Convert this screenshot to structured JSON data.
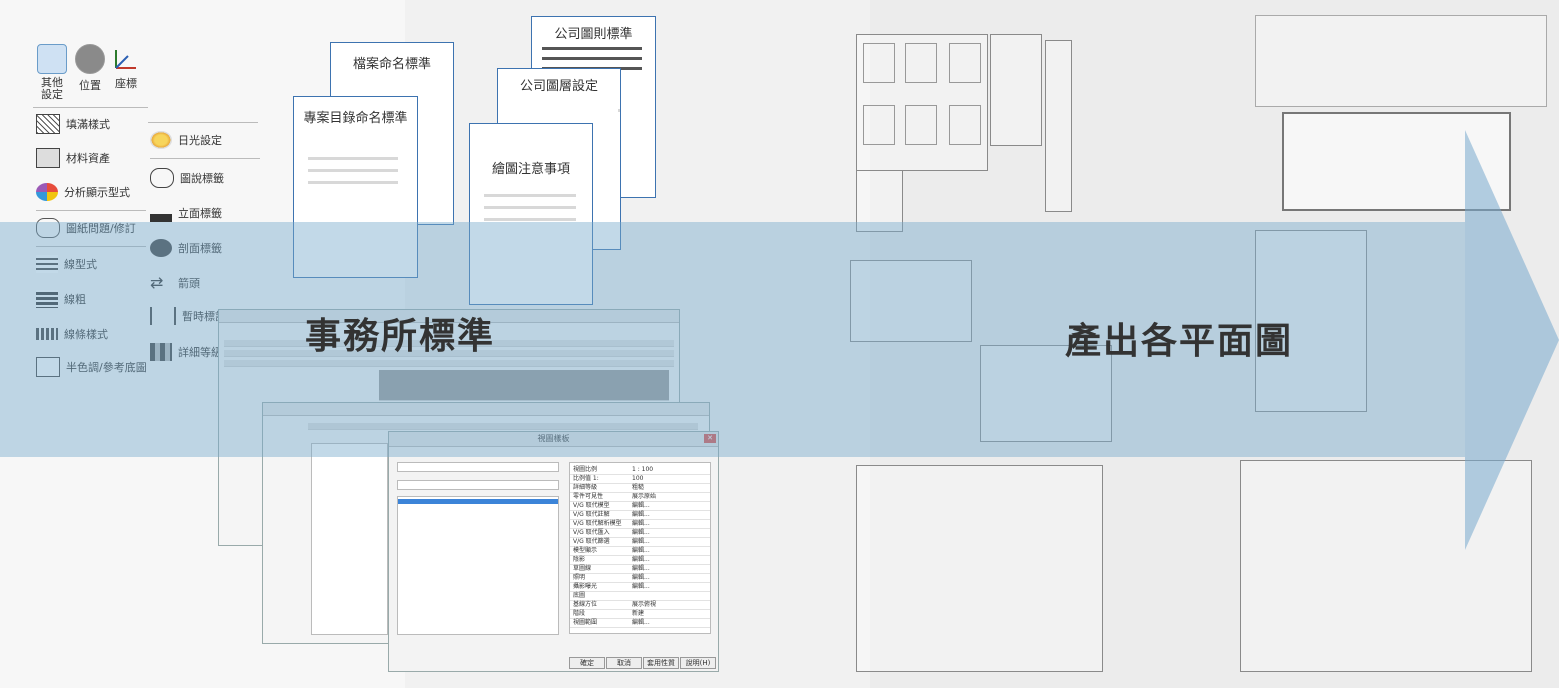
{
  "ribbon": {
    "top_buttons": [
      {
        "icon": "settings-icon",
        "label": "其他\n設定"
      },
      {
        "icon": "globe-location-icon",
        "label": "位置"
      },
      {
        "icon": "coordinates-icon",
        "label": "座標"
      }
    ],
    "left_menu": [
      {
        "icon": "fill-pattern-icon",
        "label": "填滿樣式"
      },
      {
        "icon": "material-icon",
        "label": "材料資產"
      },
      {
        "icon": "analysis-display-icon",
        "label": "分析顯示型式"
      },
      {
        "icon": "sheet-revision-icon",
        "label": "圖紙問題/修訂"
      },
      {
        "icon": "line-pattern-icon",
        "label": "線型式"
      },
      {
        "icon": "line-weight-icon",
        "label": "線粗"
      },
      {
        "icon": "line-style-icon",
        "label": "線條樣式"
      },
      {
        "icon": "halftone-icon",
        "label": "半色調/參考底圖"
      }
    ],
    "right_menu": [
      {
        "icon": "sun-settings-icon",
        "label": "日光設定"
      },
      {
        "icon": "callout-tag-icon",
        "label": "圖說標籤"
      },
      {
        "icon": "elevation-tag-icon",
        "label": "立面標籤"
      },
      {
        "icon": "section-tag-icon",
        "label": "剖面標籤"
      },
      {
        "icon": "arrowhead-icon",
        "label": "箭頭"
      },
      {
        "icon": "temporary-dimension-icon",
        "label": "暫時標註"
      },
      {
        "icon": "detail-level-icon",
        "label": "詳細等級"
      }
    ]
  },
  "documents": {
    "page1": "檔案命名標準",
    "page2": "專案目錄命名標準",
    "page3": "公司圖則標準",
    "page4": "公司圖層設定",
    "page5": "繪圖注意事項"
  },
  "band": {
    "left_title": "事務所標準",
    "right_title": "產出各平面圖"
  },
  "dialog": {
    "title": "視圖樣板",
    "ok": "確定",
    "cancel": "取消",
    "apply": "套用性質",
    "help": "說明(H)",
    "settings": [
      {
        "name": "視圖比例",
        "value": "1 : 100"
      },
      {
        "name": "比例值 1:",
        "value": "100"
      },
      {
        "name": "詳細等級",
        "value": "粗糙"
      },
      {
        "name": "零件可見性",
        "value": "展示原始"
      },
      {
        "name": "V/G 取代模型",
        "value": "編輯..."
      },
      {
        "name": "V/G 取代註解",
        "value": "編輯..."
      },
      {
        "name": "V/G 取代解析模型",
        "value": "編輯..."
      },
      {
        "name": "V/G 取代匯入",
        "value": "編輯..."
      },
      {
        "name": "V/G 取代篩選",
        "value": "編輯..."
      },
      {
        "name": "模型顯示",
        "value": "編輯..."
      },
      {
        "name": "陰影",
        "value": "編輯..."
      },
      {
        "name": "草圖線",
        "value": "編輯..."
      },
      {
        "name": "照明",
        "value": "編輯..."
      },
      {
        "name": "攝影曝光",
        "value": "編輯..."
      },
      {
        "name": "底圖",
        "value": ""
      },
      {
        "name": "基線方位",
        "value": "展示俯視"
      },
      {
        "name": "階段",
        "value": "新建"
      },
      {
        "name": "視圖範圍",
        "value": "編輯..."
      }
    ]
  },
  "colors": {
    "band": "#78aacd",
    "page_border": "#3d73b0"
  }
}
